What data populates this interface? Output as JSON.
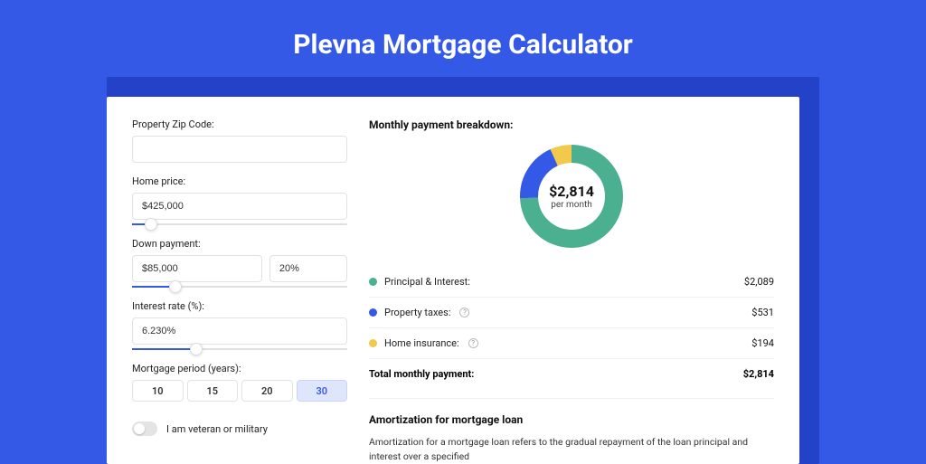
{
  "title": "Plevna Mortgage Calculator",
  "form": {
    "zip": {
      "label": "Property Zip Code:",
      "value": ""
    },
    "home_price": {
      "label": "Home price:",
      "value": "$425,000",
      "slider_pct": 9
    },
    "down_payment": {
      "label": "Down payment:",
      "amount": "$85,000",
      "percent": "20%",
      "slider_pct": 20
    },
    "interest_rate": {
      "label": "Interest rate (%):",
      "value": "6.230%",
      "slider_pct": 30
    },
    "period": {
      "label": "Mortgage period (years):",
      "options": [
        "10",
        "15",
        "20",
        "30"
      ],
      "selected": "30"
    },
    "veteran": {
      "label": "I am veteran or military",
      "checked": false
    }
  },
  "breakdown": {
    "heading": "Monthly payment breakdown:",
    "center_value": "$2,814",
    "center_sub": "per month",
    "items": [
      {
        "label": "Principal & Interest:",
        "value": "$2,089",
        "color": "#4bb08f",
        "has_info": false
      },
      {
        "label": "Property taxes:",
        "value": "$531",
        "color": "#3459e6",
        "has_info": true
      },
      {
        "label": "Home insurance:",
        "value": "$194",
        "color": "#f3c94b",
        "has_info": true
      }
    ],
    "total": {
      "label": "Total monthly payment:",
      "value": "$2,814"
    }
  },
  "amortization": {
    "heading": "Amortization for mortgage loan",
    "text": "Amortization for a mortgage loan refers to the gradual repayment of the loan principal and interest over a specified"
  },
  "chart_data": {
    "type": "pie",
    "title": "Monthly payment breakdown",
    "series": [
      {
        "name": "Principal & Interest",
        "value": 2089,
        "color": "#4bb08f"
      },
      {
        "name": "Property taxes",
        "value": 531,
        "color": "#3459e6"
      },
      {
        "name": "Home insurance",
        "value": 194,
        "color": "#f3c94b"
      }
    ],
    "total": 2814,
    "center_label": "$2,814 per month"
  }
}
